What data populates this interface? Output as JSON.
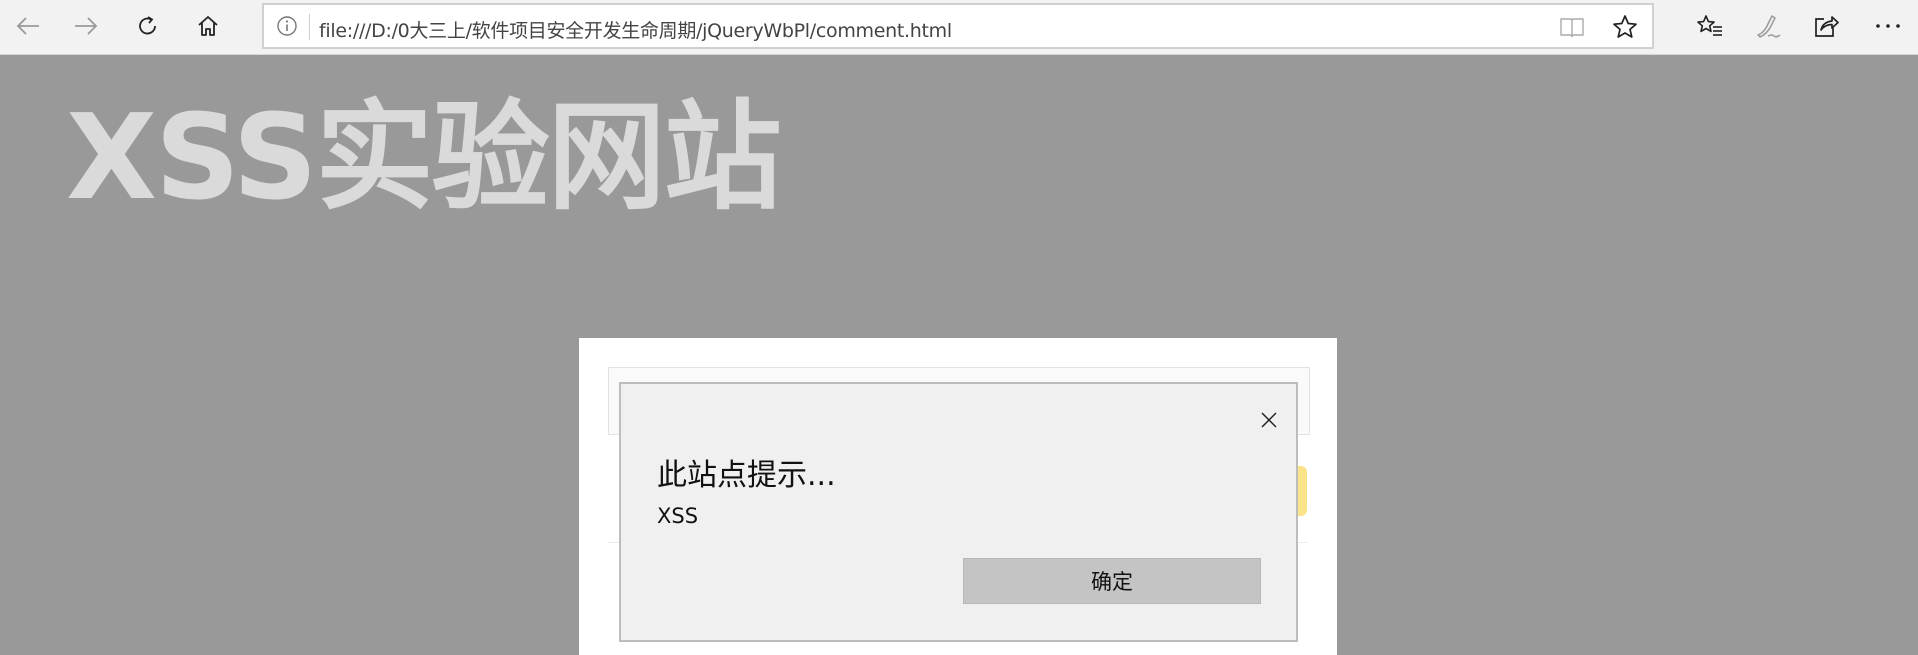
{
  "browser": {
    "url": "file:///D:/0大三上/软件项目安全开发生命周期/jQueryWbPl/comment.html",
    "icons": {
      "back": "arrow-left-icon",
      "forward": "arrow-right-icon",
      "refresh": "refresh-icon",
      "home": "home-icon",
      "info": "info-icon",
      "reading_view": "reading-view-icon",
      "favorite": "star-icon",
      "favorites_list": "favorites-list-icon",
      "notes": "pen-icon",
      "share": "share-icon",
      "more": "more-icon"
    }
  },
  "page": {
    "site_title": "XSS实验网站"
  },
  "dialog": {
    "title": "此站点提示...",
    "message": "XSS",
    "ok_label": "确定"
  },
  "colors": {
    "overlay": "#999999",
    "title": "#dadada",
    "dialog_bg": "#f0f0f0",
    "button_bg": "#c4c4c4",
    "accent_yellow": "#fbe38a"
  }
}
